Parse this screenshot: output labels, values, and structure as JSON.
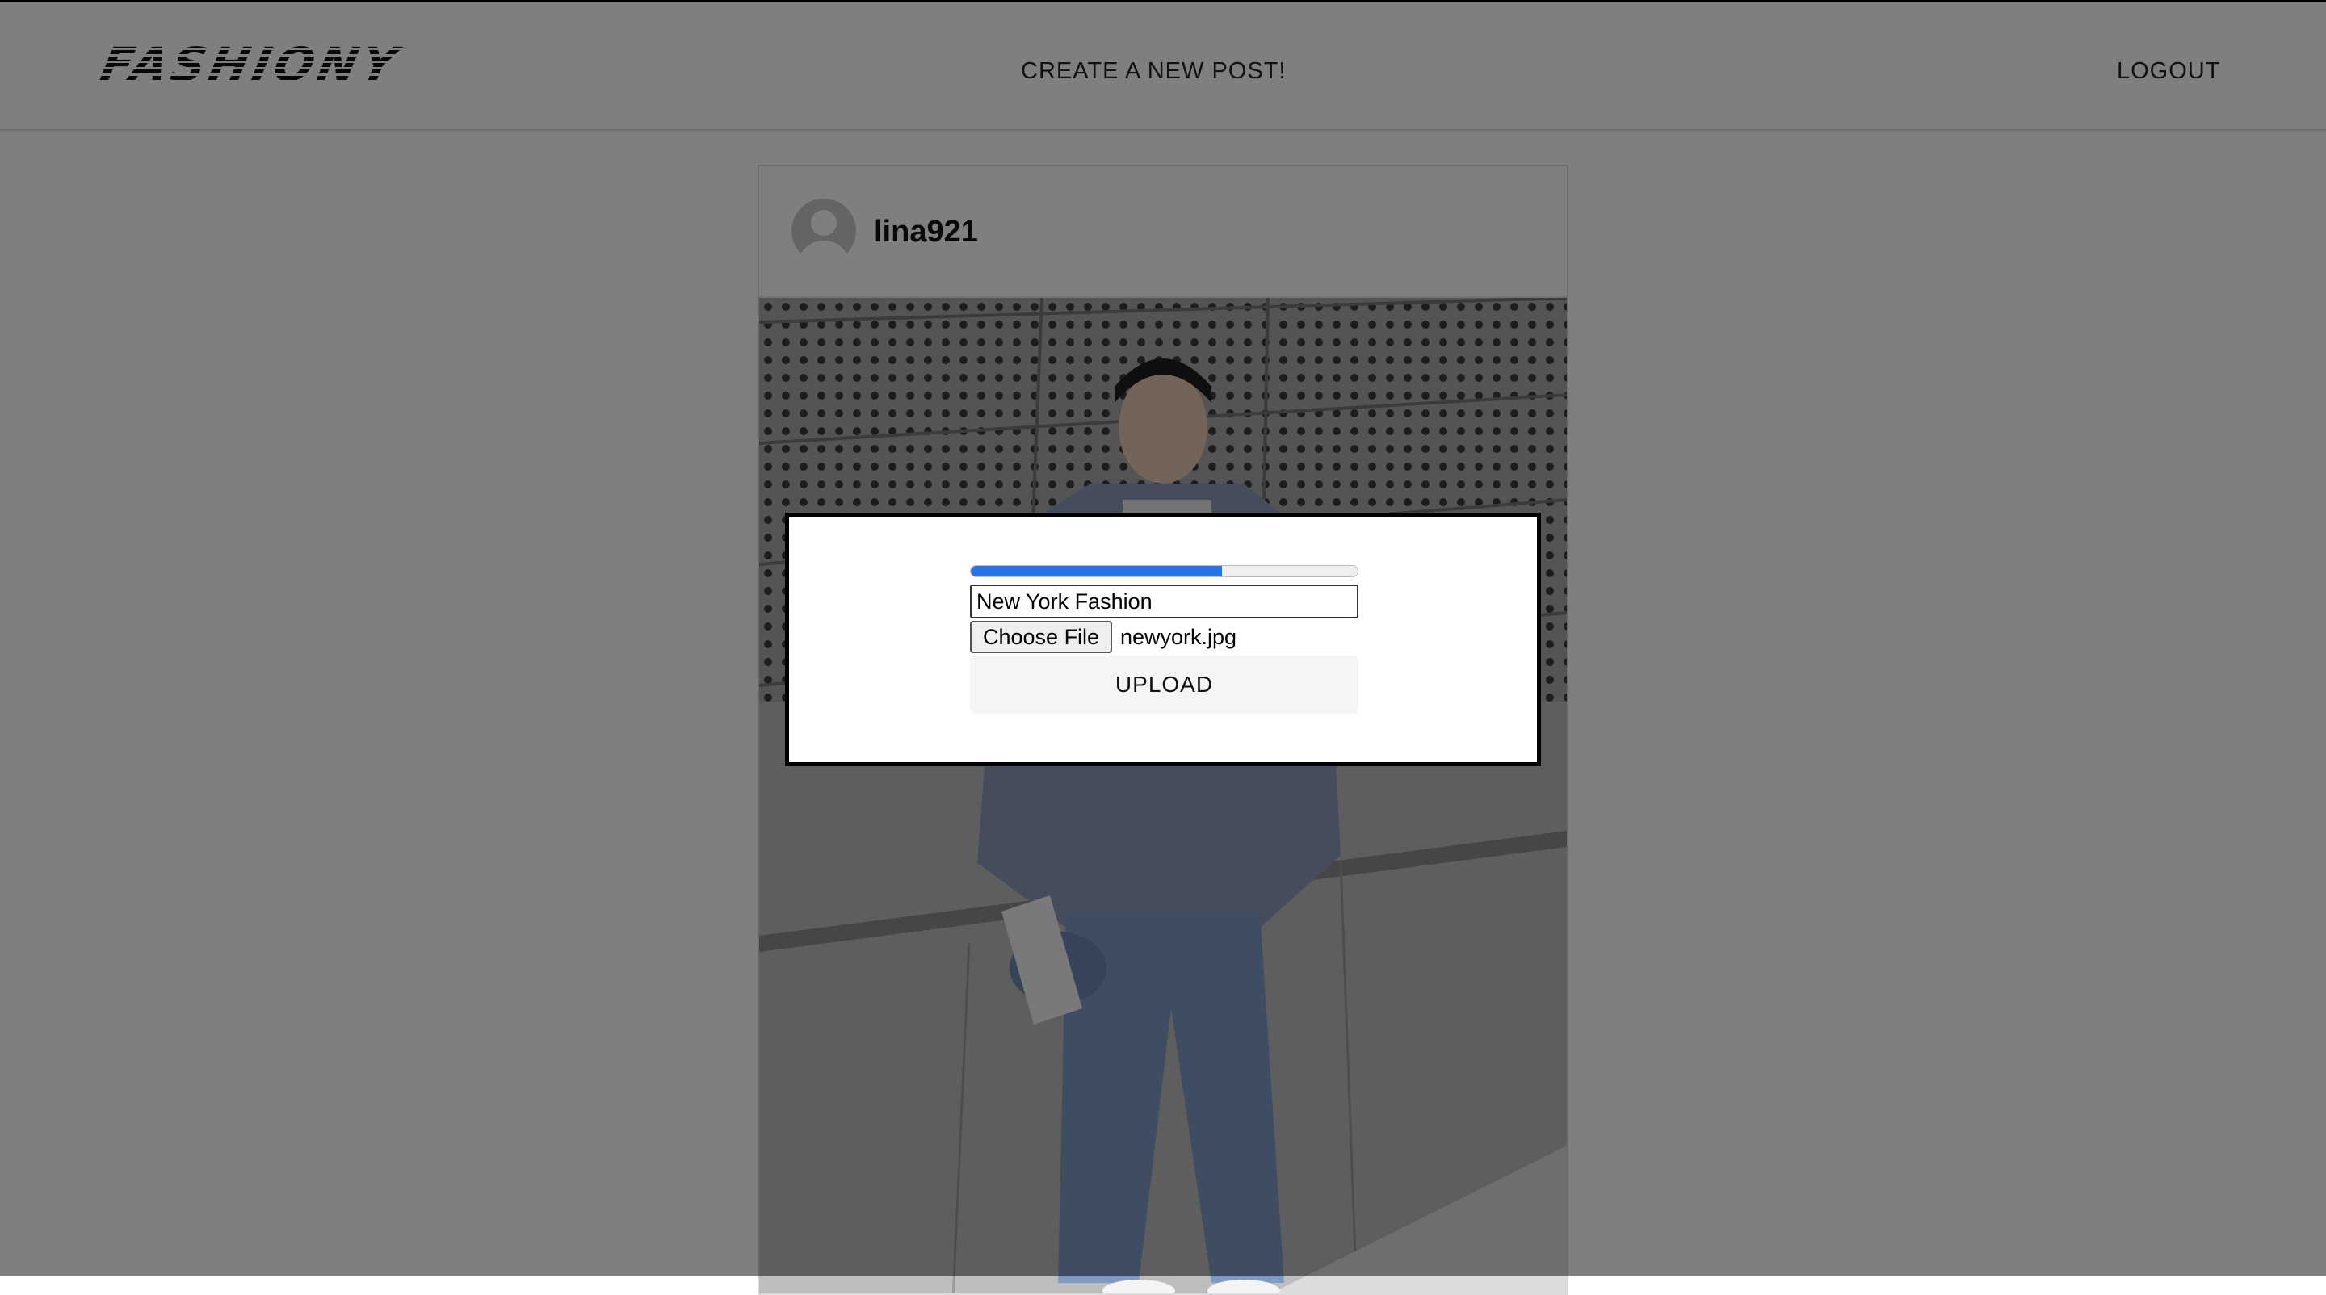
{
  "header": {
    "logo": "FASHIONY",
    "create_post_label": "CREATE A NEW POST!",
    "logout_label": "LOGOUT"
  },
  "post": {
    "username": "lina921",
    "avatar_icon": "user-avatar-icon"
  },
  "modal": {
    "progress_fraction": 0.65,
    "progress_color": "#2b74e8",
    "caption_value": "New York Fashion",
    "choose_file_label": "Choose File",
    "file_name": "newyork.jpg",
    "upload_label": "UPLOAD"
  }
}
